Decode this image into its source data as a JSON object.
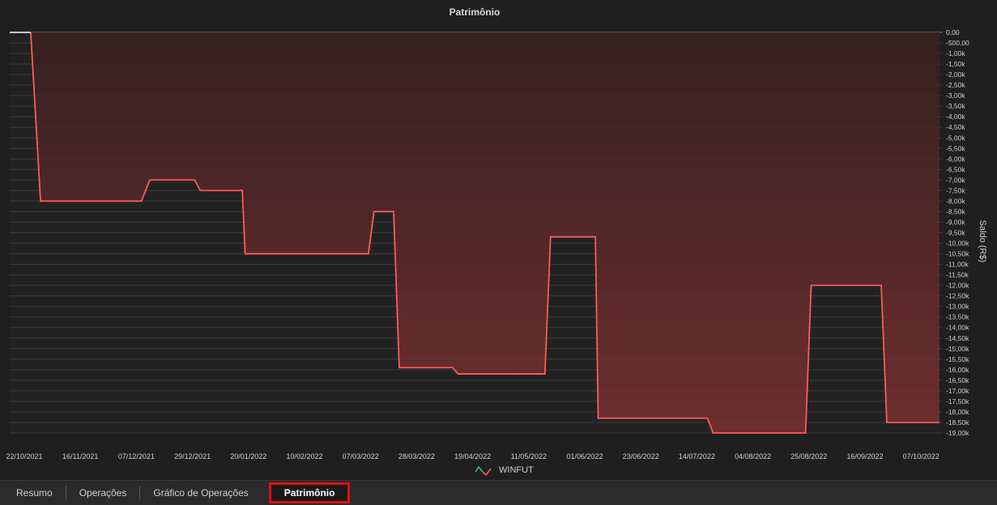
{
  "chart_data": {
    "type": "line",
    "title": "Patrimônio",
    "ylabel": "Saldo (R$)",
    "xlabel": "",
    "ylim": [
      -19000,
      0
    ],
    "y_tick_step": 500,
    "y_ticks": [
      "0,00",
      "-500,00",
      "-1,00k",
      "-1,50k",
      "-2,00k",
      "-2,50k",
      "-3,00k",
      "-3,50k",
      "-4,00k",
      "-4,50k",
      "-5,00k",
      "-5,50k",
      "-6,00k",
      "-6,50k",
      "-7,00k",
      "-7,50k",
      "-8,00k",
      "-8,50k",
      "-9,00k",
      "-9,50k",
      "-10,00k",
      "-10,50k",
      "-11,00k",
      "-11,50k",
      "-12,00k",
      "-12,50k",
      "-13,00k",
      "-13,50k",
      "-14,00k",
      "-14,50k",
      "-15,00k",
      "-15,50k",
      "-16,00k",
      "-16,50k",
      "-17,00k",
      "-17,50k",
      "-18,00k",
      "-18,50k",
      "-19,00k"
    ],
    "x_ticks": [
      "22/10/2021",
      "16/11/2021",
      "07/12/2021",
      "29/12/2021",
      "20/01/2022",
      "10/02/2022",
      "07/03/2022",
      "28/03/2022",
      "19/04/2022",
      "11/05/2022",
      "01/06/2022",
      "23/06/2022",
      "14/07/2022",
      "04/08/2022",
      "25/08/2022",
      "16/09/2022",
      "07/10/2022"
    ],
    "grid": true,
    "legend_position": "bottom-center",
    "series": [
      {
        "name": "WINFUT",
        "color": "#ff5a5a",
        "points": [
          [
            0,
            0
          ],
          [
            0.75,
            0
          ],
          [
            1.1,
            -8000
          ],
          [
            4.7,
            -8000
          ],
          [
            5.0,
            -7000
          ],
          [
            6.6,
            -7000
          ],
          [
            6.8,
            -7500
          ],
          [
            8.3,
            -7500
          ],
          [
            8.4,
            -10500
          ],
          [
            12.8,
            -10500
          ],
          [
            13.0,
            -8500
          ],
          [
            13.7,
            -8500
          ],
          [
            13.9,
            -15900
          ],
          [
            15.8,
            -15900
          ],
          [
            16.0,
            -16200
          ],
          [
            19.1,
            -16200
          ],
          [
            19.3,
            -9700
          ],
          [
            20.9,
            -9700
          ],
          [
            21.0,
            -18300
          ],
          [
            24.9,
            -18300
          ],
          [
            25.1,
            -19000
          ],
          [
            28.4,
            -19000
          ],
          [
            28.6,
            -12000
          ],
          [
            31.1,
            -12000
          ],
          [
            31.3,
            -18500
          ],
          [
            32.0,
            -18500
          ]
        ]
      }
    ]
  },
  "tabs": [
    {
      "label": "Resumo",
      "active": false
    },
    {
      "label": "Operações",
      "active": false
    },
    {
      "label": "Gráfico de Operações",
      "active": false
    },
    {
      "label": "Patrimônio",
      "active": true
    }
  ]
}
